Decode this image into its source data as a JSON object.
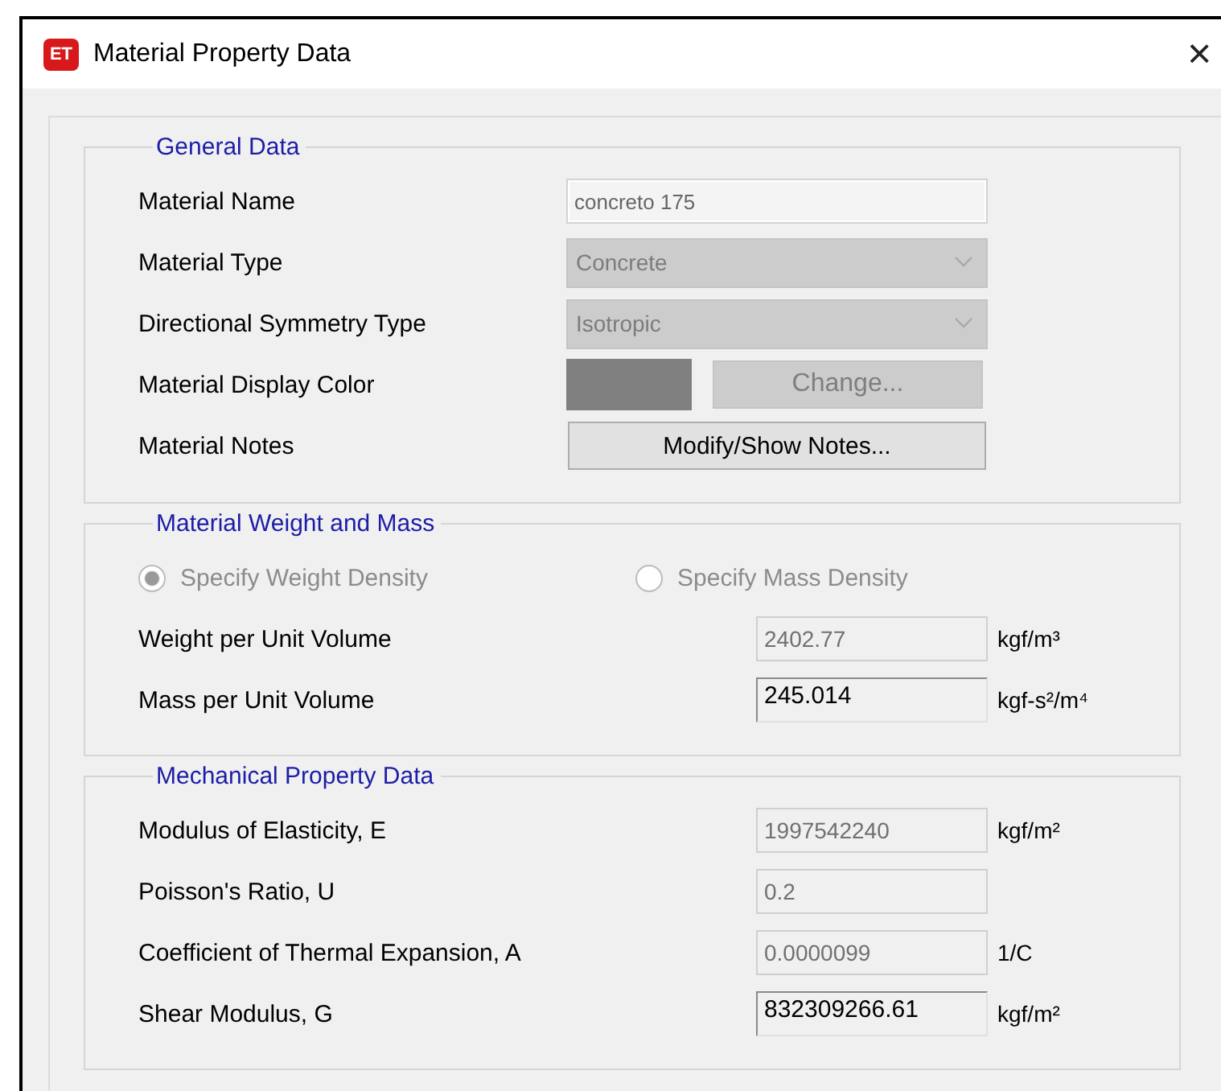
{
  "window": {
    "icon_text": "ET",
    "title": "Material Property Data",
    "close": "×"
  },
  "groups": [
    {
      "kind": "general",
      "title": "General Data",
      "rows": [
        {
          "kind": "text",
          "label": "Material Name",
          "value": "concreto 175",
          "disabled": true
        },
        {
          "kind": "dropdown",
          "label": "Material Type",
          "value": "Concrete",
          "disabled": true
        },
        {
          "kind": "dropdown",
          "label": "Directional Symmetry Type",
          "value": "Isotropic",
          "disabled": true
        },
        {
          "kind": "color",
          "label": "Material Display Color",
          "color": "#808080",
          "button": "Change...",
          "disabled": true
        },
        {
          "kind": "button",
          "label": "Material Notes",
          "button": "Modify/Show Notes...",
          "disabled": false
        }
      ]
    },
    {
      "kind": "values",
      "title": "Material Weight and Mass",
      "radios": [
        {
          "label": "Specify Weight Density",
          "selected": true,
          "disabled": true
        },
        {
          "label": "Specify Mass Density",
          "selected": false,
          "disabled": true
        }
      ],
      "rows": [
        {
          "kind": "number",
          "label": "Weight per Unit Volume",
          "value": "2402.77",
          "unit": "kgf/m³",
          "disabled": true
        },
        {
          "kind": "number",
          "label": "Mass per Unit Volume",
          "value": "245.014",
          "unit": "kgf-s²/m⁴",
          "disabled": false
        }
      ]
    },
    {
      "kind": "values",
      "title": "Mechanical Property Data",
      "rows": [
        {
          "kind": "number",
          "label": "Modulus of Elasticity,  E",
          "value": "1997542240",
          "unit": "kgf/m²",
          "disabled": true
        },
        {
          "kind": "number",
          "label": "Poisson's Ratio,  U",
          "value": "0.2",
          "disabled": true
        },
        {
          "kind": "number",
          "label": "Coefficient of Thermal Expansion,  A",
          "value": "0.0000099",
          "unit": "1/C",
          "disabled": true
        },
        {
          "kind": "number",
          "label": "Shear Modulus,  G",
          "value": "832309266.61",
          "unit": "kgf/m²",
          "disabled": false
        }
      ]
    }
  ]
}
